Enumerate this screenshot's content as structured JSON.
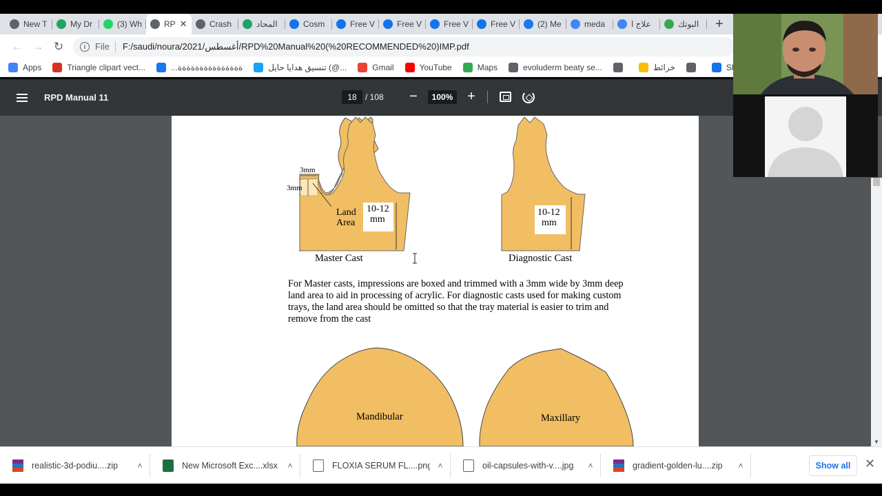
{
  "browser": {
    "tabs": [
      {
        "label": "New T",
        "icon": "chrome-icon",
        "color": "#5f6368",
        "active": false
      },
      {
        "label": "My Dr",
        "icon": "drive-icon",
        "color": "#1fa463",
        "active": false
      },
      {
        "label": "(3) Wh",
        "icon": "whatsapp-icon",
        "color": "#25d366",
        "active": false
      },
      {
        "label": "RP",
        "icon": "globe-icon",
        "color": "#5f6368",
        "active": true
      },
      {
        "label": "Crash",
        "icon": "globe-icon",
        "color": "#5f6368",
        "active": false
      },
      {
        "label": "المحاد",
        "icon": "drive-icon",
        "color": "#1fa463",
        "active": false
      },
      {
        "label": "Cosm",
        "icon": "freepik-icon",
        "color": "#1273eb",
        "active": false
      },
      {
        "label": "Free V",
        "icon": "freepik-icon",
        "color": "#1273eb",
        "active": false
      },
      {
        "label": "Free V",
        "icon": "freepik-icon",
        "color": "#1273eb",
        "active": false
      },
      {
        "label": "Free V",
        "icon": "freepik-icon",
        "color": "#1273eb",
        "active": false
      },
      {
        "label": "Free V",
        "icon": "freepik-icon",
        "color": "#1273eb",
        "active": false
      },
      {
        "label": "(2) Me",
        "icon": "facebook-icon",
        "color": "#1877f2",
        "active": false
      },
      {
        "label": "meda",
        "icon": "google-icon",
        "color": "#4285f4",
        "active": false
      },
      {
        "label": "علاج ا",
        "icon": "google-icon",
        "color": "#4285f4",
        "active": false
      },
      {
        "label": "البوتك",
        "icon": "leaf-icon",
        "color": "#34a853",
        "active": false
      }
    ],
    "address": {
      "scheme": "File",
      "url": "F:/saudi/noura/2021/أغسطس/RPD%20Manual%20(%20RECOMMENDED%20)IMP.pdf"
    },
    "bookmarks": [
      {
        "label": "Apps",
        "icon": "apps-grid-icon",
        "color": "#4285f4"
      },
      {
        "label": "Triangle clipart vect...",
        "icon": "pin-icon",
        "color": "#d93025"
      },
      {
        "label": "...ةةةةةةةةةةةةةةة",
        "icon": "facebook-icon",
        "color": "#1877f2"
      },
      {
        "label": "تنسيق هدايا حايل (@...",
        "icon": "twitter-icon",
        "color": "#1da1f2"
      },
      {
        "label": "Gmail",
        "icon": "gmail-icon",
        "color": "#ea4335"
      },
      {
        "label": "YouTube",
        "icon": "youtube-icon",
        "color": "#ff0000"
      },
      {
        "label": "Maps",
        "icon": "maps-icon",
        "color": "#34a853"
      },
      {
        "label": "evoluderm beaty se...",
        "icon": "globe-icon",
        "color": "#5f6368"
      },
      {
        "label": "",
        "icon": "globe-icon",
        "color": "#5f6368"
      },
      {
        "label": "خرائط",
        "icon": "maps-pin-icon",
        "color": "#fbbc04"
      },
      {
        "label": "",
        "icon": "globe-icon",
        "color": "#5f6368"
      },
      {
        "label": "Shirtless mar",
        "icon": "freepik-icon",
        "color": "#1273eb"
      }
    ]
  },
  "pdf": {
    "title": "RPD Manual 11",
    "page_current": "18",
    "page_total": "/ 108",
    "zoom": "100%",
    "content": {
      "label_3mm_top": "3mm",
      "label_3mm_side": "3mm",
      "label_land": "Land",
      "label_area": "Area",
      "label_measure_1a": "10-12",
      "label_measure_1b": "mm",
      "label_measure_2a": "10-12",
      "label_measure_2b": "mm",
      "caption_master": "Master Cast",
      "caption_diagnostic": "Diagnostic Cast",
      "paragraph_lines": [
        "For Master casts, impressions are boxed and trimmed with a 3mm wide by 3mm deep",
        "land area to aid in processing of acrylic.  For diagnostic casts used for making custom",
        "trays, the land area should be omitted so that the tray material is easier to trim and",
        "remove from the cast"
      ],
      "label_mandibular": "Mandibular",
      "label_maxillary": "Maxillary"
    },
    "cast_color": "#f1be64"
  },
  "downloads": {
    "items": [
      {
        "name": "realistic-3d-podiu....zip",
        "icon": "winrar-icon"
      },
      {
        "name": "New Microsoft Exc....xlsx",
        "icon": "excel-icon"
      },
      {
        "name": "FLOXIA SERUM FL....png",
        "icon": "image-file-icon"
      },
      {
        "name": "oil-capsules-with-v....jpg",
        "icon": "image-file-icon"
      },
      {
        "name": "gradient-golden-lu....zip",
        "icon": "winrar-icon"
      }
    ],
    "show_all": "Show all"
  }
}
